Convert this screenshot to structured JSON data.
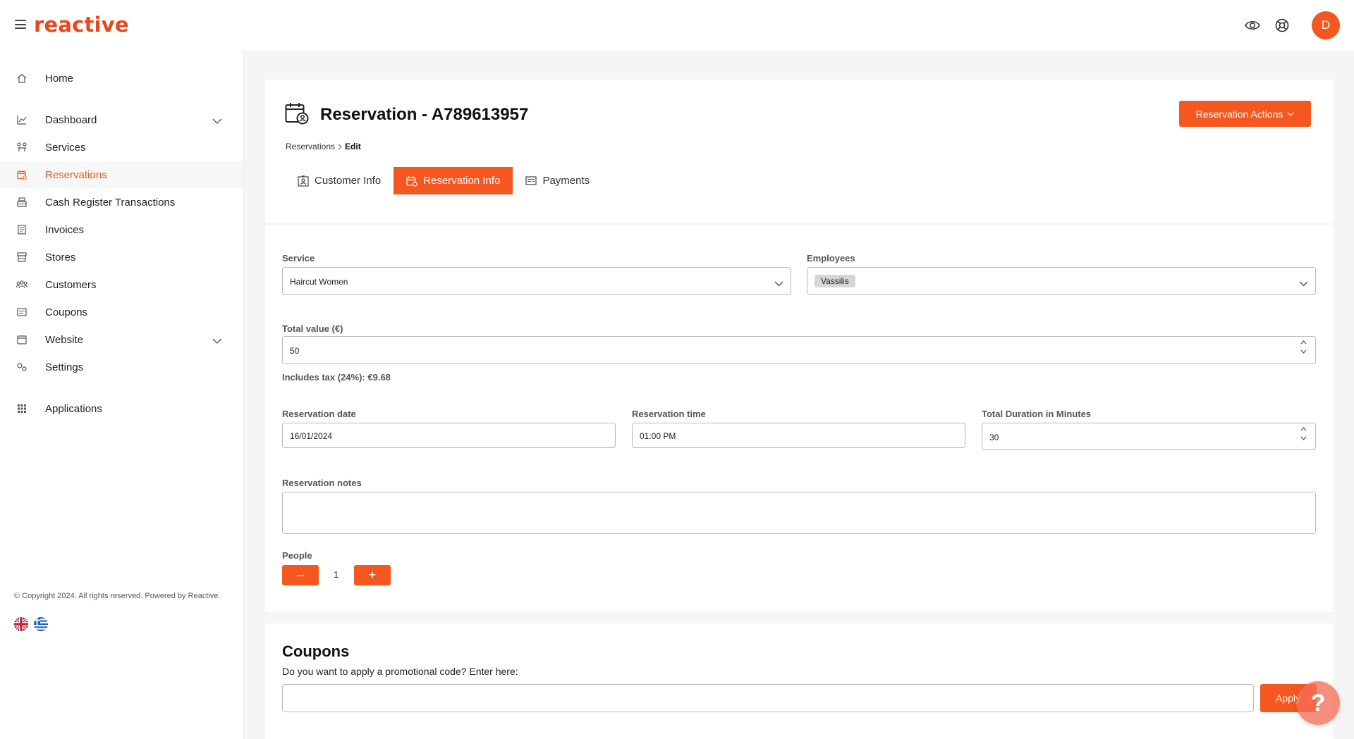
{
  "app": {
    "logo": "reactive"
  },
  "header": {
    "avatar_letter": "D",
    "icons": [
      "eye-icon",
      "lifebuoy-icon"
    ]
  },
  "sidebar": {
    "items": [
      {
        "label": "Home",
        "icon": "home-icon"
      },
      {
        "label": "Dashboard",
        "icon": "chart-icon",
        "expandable": true
      },
      {
        "label": "Services",
        "icon": "services-icon"
      },
      {
        "label": "Reservations",
        "icon": "calendar-icon",
        "active": true
      },
      {
        "label": "Cash Register Transactions",
        "icon": "register-icon"
      },
      {
        "label": "Invoices",
        "icon": "invoice-icon"
      },
      {
        "label": "Stores",
        "icon": "store-icon"
      },
      {
        "label": "Customers",
        "icon": "customers-icon"
      },
      {
        "label": "Coupons",
        "icon": "coupon-icon"
      },
      {
        "label": "Website",
        "icon": "website-icon",
        "expandable": true
      },
      {
        "label": "Settings",
        "icon": "settings-icon"
      },
      {
        "label": "Applications",
        "icon": "grid-icon"
      }
    ],
    "copyright": "© Copyright 2024. All rights reserved. Powered by Reactive.",
    "languages": [
      "English",
      "Greek"
    ]
  },
  "page": {
    "title": "Reservation - A789613957",
    "actions_label": "Reservation Actions",
    "breadcrumb": {
      "parent": "Reservations",
      "current": "Edit"
    },
    "tabs": [
      {
        "label": "Customer Info"
      },
      {
        "label": "Reservation Info",
        "active": true
      },
      {
        "label": "Payments"
      }
    ]
  },
  "form": {
    "service": {
      "label": "Service",
      "value": "Haircut Women"
    },
    "employees": {
      "label": "Employees",
      "selected": [
        "Vassilis"
      ]
    },
    "total_value": {
      "label": "Total value (€)",
      "value": "50",
      "tax_note": "Includes tax (24%): €9.68"
    },
    "reservation_date": {
      "label": "Reservation date",
      "value": "16/01/2024"
    },
    "reservation_time": {
      "label": "Reservation time",
      "value": "01:00 PM"
    },
    "total_duration": {
      "label": "Total Duration in Minutes",
      "value": "30"
    },
    "reservation_notes": {
      "label": "Reservation notes",
      "value": ""
    },
    "people": {
      "label": "People",
      "value": "1",
      "minus": "–",
      "plus": "+"
    }
  },
  "coupons": {
    "title": "Coupons",
    "subtitle": "Do you want to apply a promotional code? Enter here:",
    "input_value": "",
    "apply_label": "Apply"
  },
  "help": {
    "label": "?"
  },
  "colors": {
    "accent": "#f4571f"
  }
}
